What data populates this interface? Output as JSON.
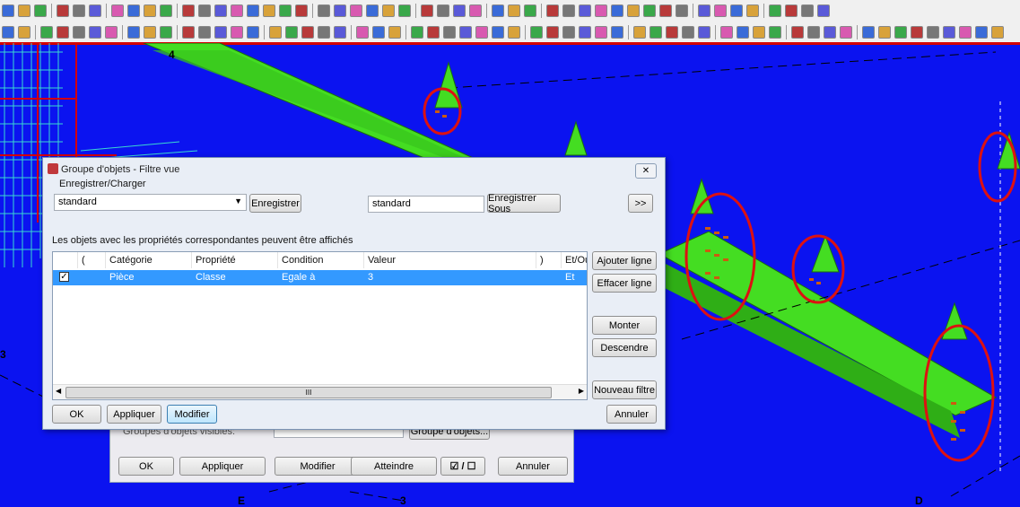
{
  "viewport": {
    "labels": [
      "4",
      "3",
      "E",
      "3",
      "D"
    ]
  },
  "back_dialog": {
    "checkbox_label": "Groupes d'objets visibles:",
    "group_button": "Groupe d'objets...",
    "buttons": {
      "ok": "OK",
      "apply": "Appliquer",
      "modify": "Modifier",
      "reach": "Atteindre",
      "toggle": "☑ / ☐",
      "cancel": "Annuler"
    }
  },
  "dialog": {
    "title": "Groupe d'objets - Filtre vue",
    "close": "✕",
    "save_load_label": "Enregistrer/Charger",
    "preset_select": "standard",
    "save_button": "Enregistrer",
    "save_as_input": "standard",
    "save_as_button": "Enregistrer Sous",
    "more_button": ">>",
    "description": "Les objets avec les propriétés correspondantes peuvent être affichés",
    "columns": [
      "(",
      "Catégorie",
      "Propriété",
      "Condition",
      "Valeur",
      ")",
      "Et/Ou"
    ],
    "rows": [
      {
        "checked": true,
        "paren_open": "",
        "category": "Pièce",
        "property": "Classe",
        "condition": "Egale à",
        "value": "3",
        "paren_close": "",
        "andor": "Et"
      }
    ],
    "side_buttons": {
      "add": "Ajouter ligne",
      "delete": "Effacer ligne",
      "up": "Monter",
      "down": "Descendre",
      "new_filter": "Nouveau filtre"
    },
    "scroll_thumb": "III",
    "bottom_buttons": {
      "ok": "OK",
      "apply": "Appliquer",
      "modify": "Modifier",
      "cancel": "Annuler"
    }
  },
  "colors": {
    "background": "#0b13f0",
    "beam": "#44dd22",
    "highlight_circle": "#dd1111",
    "selection": "#3399ff"
  }
}
